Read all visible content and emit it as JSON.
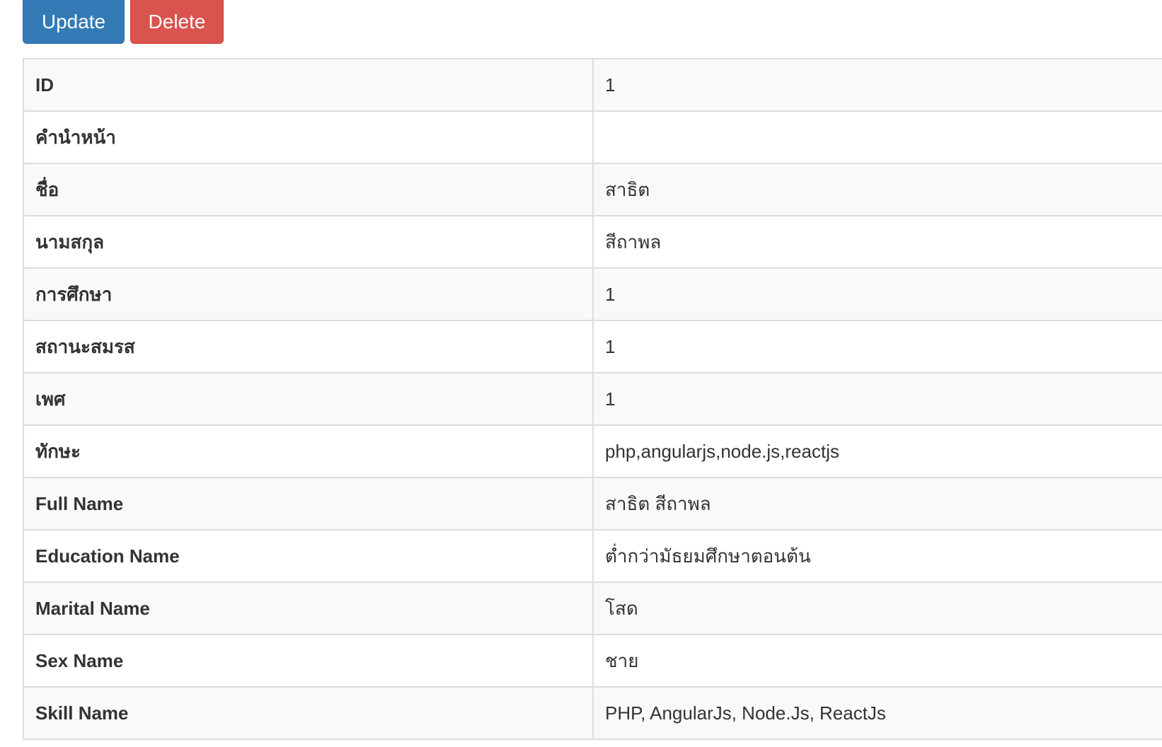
{
  "toolbar": {
    "update_label": "Update",
    "delete_label": "Delete"
  },
  "detail": {
    "rows": [
      {
        "label": "ID",
        "value": "1"
      },
      {
        "label": "คำนำหน้า",
        "value": ""
      },
      {
        "label": "ชื่อ",
        "value": "สาธิต"
      },
      {
        "label": "นามสกุล",
        "value": "สีถาพล"
      },
      {
        "label": "การศึกษา",
        "value": "1"
      },
      {
        "label": "สถานะสมรส",
        "value": "1"
      },
      {
        "label": "เพศ",
        "value": "1"
      },
      {
        "label": "ทักษะ",
        "value": "php,angularjs,node.js,reactjs"
      },
      {
        "label": "Full Name",
        "value": "สาธิต สีถาพล"
      },
      {
        "label": "Education Name",
        "value": "ต่ำกว่ามัธยมศึกษาตอนต้น"
      },
      {
        "label": "Marital Name",
        "value": "โสด"
      },
      {
        "label": "Sex Name",
        "value": "ชาย"
      },
      {
        "label": "Skill Name",
        "value": "PHP, AngularJs, Node.Js, ReactJs"
      }
    ]
  },
  "colors": {
    "primary": "#337ab7",
    "danger": "#d9534f",
    "border": "#dddddd",
    "stripe": "#f9f9f9",
    "text": "#333333"
  }
}
